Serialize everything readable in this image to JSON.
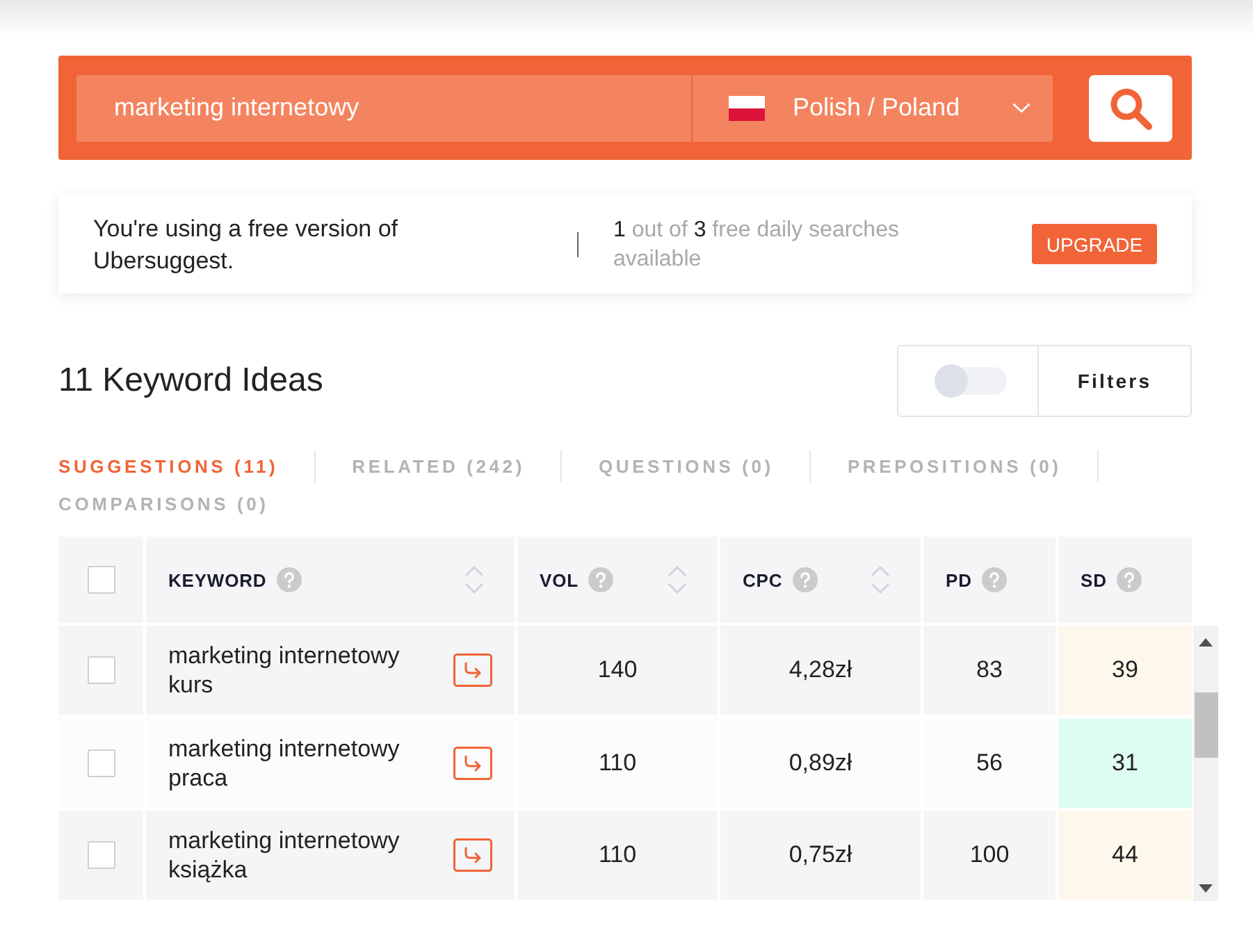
{
  "search": {
    "value": "marketing internetowy",
    "language": "Polish / Poland"
  },
  "notice": {
    "message": "You're using a free version of Ubersuggest.",
    "quota": "**1** out of **3** free daily searches available",
    "button": "UPGRADE"
  },
  "results": {
    "title": "11 Keyword Ideas",
    "filter_toggle_on": false,
    "filters_button": "Filters"
  },
  "tabs": [
    {
      "label": "SUGGESTIONS (11)",
      "selected": true
    },
    {
      "label": "RELATED (242)",
      "selected": false
    },
    {
      "label": "QUESTIONS (0)",
      "selected": false
    },
    {
      "label": "PREPOSITIONS (0)",
      "selected": false
    },
    {
      "label": "COMPARISONS (0)",
      "selected": false
    }
  ],
  "table": {
    "select_all_checked": false,
    "columns": [
      {
        "label": "KEYWORD",
        "sortable": true
      },
      {
        "label": "VOL",
        "sortable": true
      },
      {
        "label": "CPC",
        "sortable": true
      },
      {
        "label": "PD",
        "sortable": false
      },
      {
        "label": "SD",
        "sortable": false
      }
    ],
    "rows": [
      {
        "checked": false,
        "keyword": "marketing internetowy kurs",
        "vol": "140",
        "cpc": "4,28zł",
        "pd": "83",
        "sd": {
          "value": "39",
          "color": "#fef8ec"
        }
      },
      {
        "checked": false,
        "keyword": "marketing internetowy praca",
        "vol": "110",
        "cpc": "0,89zł",
        "pd": "56",
        "sd": {
          "value": "31",
          "color": "#dcfdef"
        }
      },
      {
        "checked": false,
        "keyword": "marketing internetowy książka",
        "vol": "110",
        "cpc": "0,75zł",
        "pd": "100",
        "sd": {
          "value": "44",
          "color": "#fef8ec"
        }
      }
    ]
  }
}
